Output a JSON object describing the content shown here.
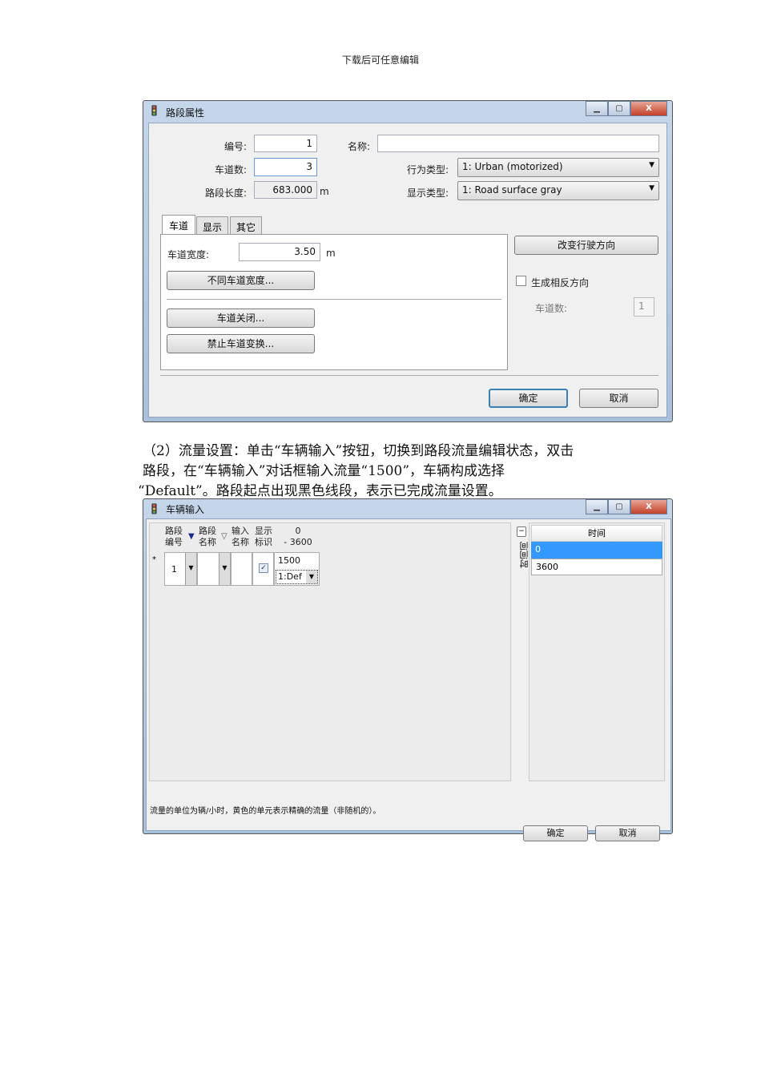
{
  "header": "下载后可任意编辑",
  "dialog1": {
    "title": "路段属性",
    "number_label": "编号:",
    "number_value": "1",
    "name_label": "名称:",
    "name_value": "",
    "lanes_label": "车道数:",
    "lanes_value": "3",
    "length_label": "路段长度:",
    "length_value": "683.000",
    "length_unit": "m",
    "behavior_label": "行为类型:",
    "behavior_value": "1: Urban (motorized)",
    "display_label": "显示类型:",
    "display_value": "1: Road surface gray",
    "tabs": [
      "车道",
      "显示",
      "其它"
    ],
    "lane_width_label": "车道宽度:",
    "lane_width_value": "3.50",
    "lane_width_unit": "m",
    "diff_width_button": "不同车道宽度...",
    "lane_close_button": "车道关闭...",
    "no_lane_change_button": "禁止车道变换...",
    "change_direction_button": "改变行驶方向",
    "opposite_checkbox": "生成相反方向",
    "opp_lanes_label": "车道数:",
    "opp_lanes_value": "1",
    "ok": "确定",
    "cancel": "取消"
  },
  "paragraph": [
    "（2）流量设置：单击“车辆输入”按钮，切换到路段流量编辑状态，双击",
    "路段，在“车辆输入”对话框输入流量“1500”，车辆构成选择",
    "“Default”。路段起点出现黑色线段，表示已完成流量设置。"
  ],
  "dialog2": {
    "title": "车辆输入",
    "columns": [
      "路段\n编号",
      "路段\n名称",
      "输入\n名称",
      "显示\n标识",
      "0\n- 3600"
    ],
    "row": {
      "marker": "*",
      "link": "1",
      "volume": "1500",
      "composition": "1:Def",
      "checked": true
    },
    "side_label": "时间间",
    "time_header": "时间",
    "times": [
      "0",
      "3600"
    ],
    "status": "流量的单位为辆/小时，黄色的单元表示精确的流量（非随机的）。",
    "ok": "确定",
    "cancel": "取消"
  }
}
